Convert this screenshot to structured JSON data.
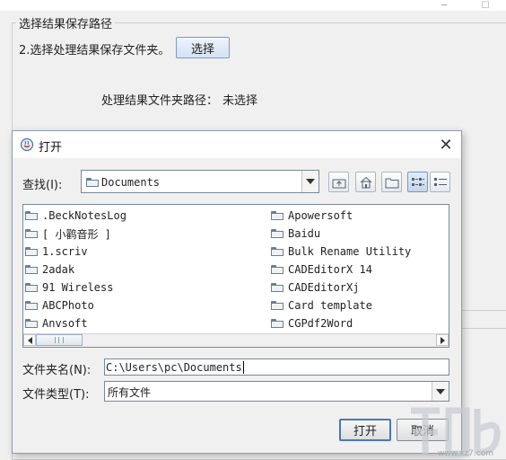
{
  "background": {
    "panel_title": "选择结果保存路径",
    "step_label": "2.选择处理结果保存文件夹。",
    "select_button": "选择",
    "path_label": "处理结果文件夹路径：",
    "path_value": "未选择"
  },
  "dialog": {
    "title": "打开",
    "look_in_label": "查找(I):",
    "look_in_value": "Documents",
    "toolbar": [
      "up-one-level",
      "home",
      "new-folder",
      "list-view",
      "details-view"
    ],
    "files_left": [
      ".BeckNotesLog",
      "[ 小鹳音形 ]",
      "1.scriv",
      "2adak",
      "91 Wireless",
      "ABCPhoto",
      "Anvsoft"
    ],
    "files_right": [
      "Apowersoft",
      "Baidu",
      "Bulk Rename Utility",
      "CADEditorX 14",
      "CADEditorXj",
      "Card template",
      "CGPdf2Word"
    ],
    "folder_name_label": "文件夹名(N):",
    "folder_name_value": "C:\\Users\\pc\\Documents",
    "file_type_label": "文件类型(T):",
    "file_type_value": "所有文件",
    "open_button": "打开",
    "cancel_button": "取消"
  },
  "watermark": {
    "url": "www.xz7.com"
  },
  "colors": {
    "dialog_border": "#8c9cb0",
    "default_button_border": "#4b78b8",
    "window_bg": "#f0f0f0"
  }
}
